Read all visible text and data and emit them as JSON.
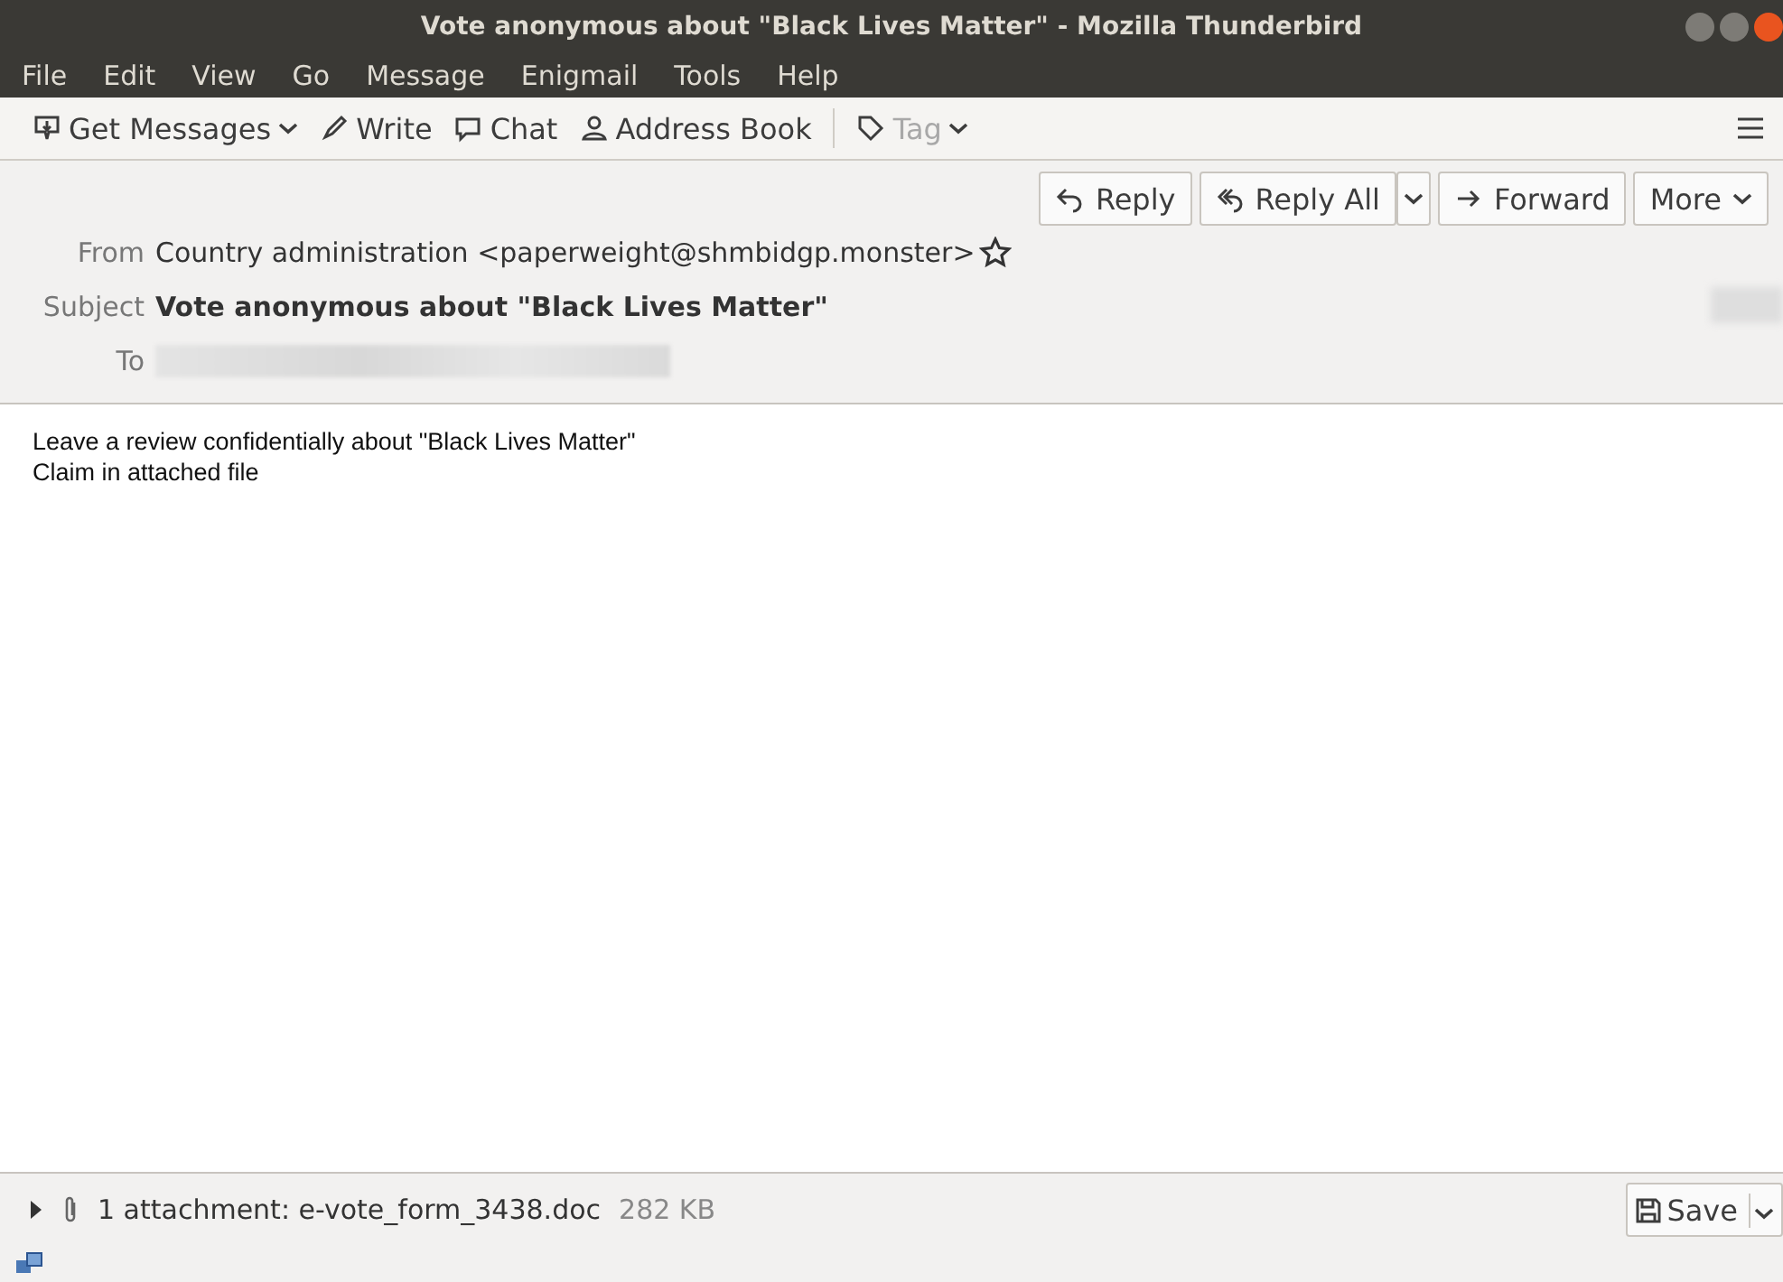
{
  "window": {
    "title": "Vote anonymous about \"Black Lives Matter\" - Mozilla Thunderbird"
  },
  "menu": [
    "File",
    "Edit",
    "View",
    "Go",
    "Message",
    "Enigmail",
    "Tools",
    "Help"
  ],
  "toolbar": [
    {
      "kind": "get",
      "label": "Get Messages",
      "disabled": false
    },
    {
      "kind": "write",
      "label": "Write",
      "disabled": false
    },
    {
      "kind": "chat",
      "label": "Chat",
      "disabled": false
    },
    {
      "kind": "address",
      "label": "Address Book",
      "disabled": false
    },
    {
      "kind": "tag",
      "label": "Tag",
      "disabled": true
    }
  ],
  "actions": [
    {
      "kind": "reply",
      "label": "Reply"
    },
    {
      "kind": "replyall",
      "label": "Reply All"
    },
    {
      "kind": "forward",
      "label": "Forward"
    },
    {
      "kind": "more",
      "label": "More"
    }
  ],
  "header": {
    "from_label": "From",
    "from": "Country administration <paperweight@shmbidgp.monster>",
    "subject_label": "Subject",
    "subject": "Vote anonymous about \"Black Lives Matter\"",
    "to_label": "To"
  },
  "body": [
    "Leave a review confidentially about \"Black Lives Matter\"",
    "Claim in attached file"
  ],
  "attachment": {
    "expanded": false,
    "summary": "1 attachment: e-vote_form_3438.doc",
    "size": "282 KB",
    "save": "Save"
  }
}
